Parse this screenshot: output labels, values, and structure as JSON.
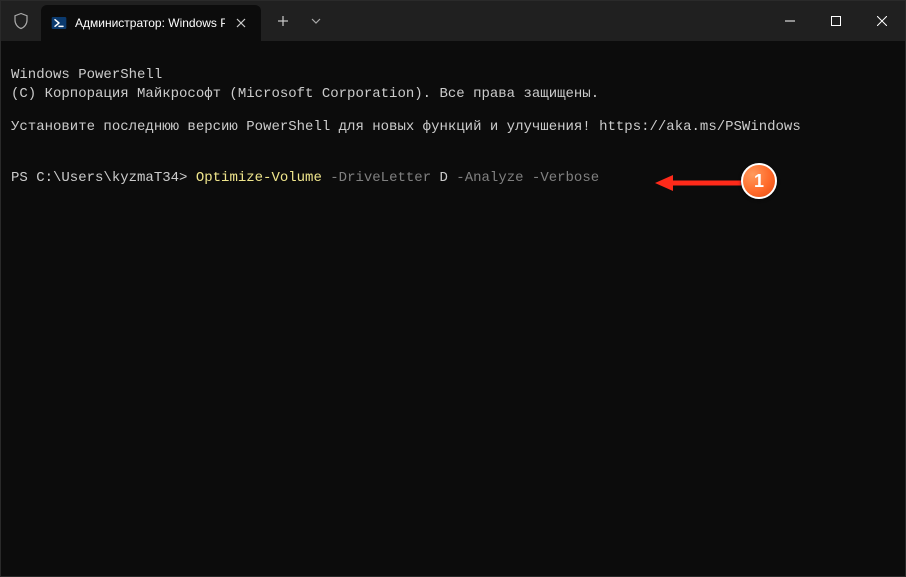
{
  "tab": {
    "title": "Администратор: Windows Po"
  },
  "terminal": {
    "header_line1": "Windows PowerShell",
    "header_line2": "(C) Корпорация Майкрософт (Microsoft Corporation). Все права защищены.",
    "update_line": "Установите последнюю версию PowerShell для новых функций и улучшения! https://aka.ms/PSWindows",
    "prompt_prefix": "PS C:\\Users\\kyzmaT34> ",
    "cmdlet": "Optimize-Volume",
    "param1": " -DriveLetter ",
    "arg1": "D",
    "param2": " -Analyze ",
    "param3": "-Verbose"
  },
  "annotation": {
    "badge": "1"
  }
}
